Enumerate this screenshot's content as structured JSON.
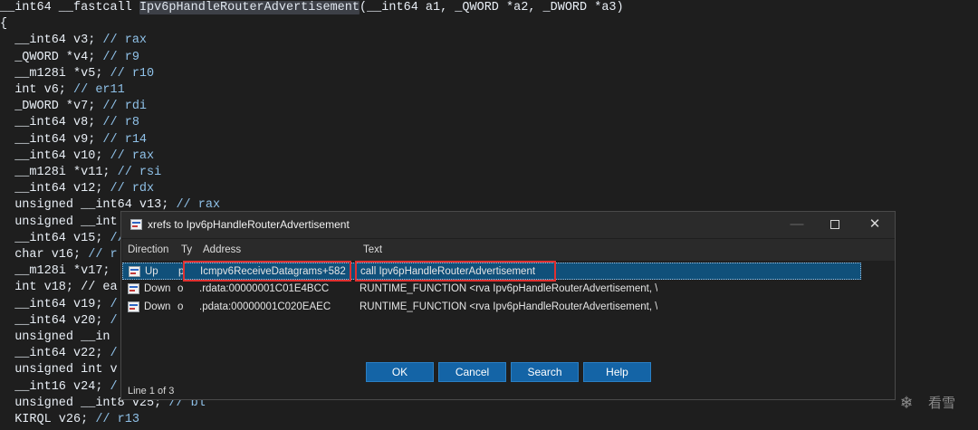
{
  "code": {
    "lines": [
      {
        "pre": "__int64 __fastcall ",
        "hl": "Ipv6pHandleRouterAdvertisement",
        "post": "(__int64 a1, _QWORD *a2, _DWORD *a3)",
        "comment": ""
      },
      {
        "pre": "{",
        "hl": "",
        "post": "",
        "comment": ""
      },
      {
        "pre": "  __int64 v3; ",
        "hl": "",
        "post": "",
        "comment": "// rax"
      },
      {
        "pre": "  _QWORD *v4; ",
        "hl": "",
        "post": "",
        "comment": "// r9"
      },
      {
        "pre": "  __m128i *v5; ",
        "hl": "",
        "post": "",
        "comment": "// r10"
      },
      {
        "pre": "  int v6; ",
        "hl": "",
        "post": "",
        "comment": "// er11"
      },
      {
        "pre": "  _DWORD *v7; ",
        "hl": "",
        "post": "",
        "comment": "// rdi"
      },
      {
        "pre": "  __int64 v8; ",
        "hl": "",
        "post": "",
        "comment": "// r8"
      },
      {
        "pre": "  __int64 v9; ",
        "hl": "",
        "post": "",
        "comment": "// r14"
      },
      {
        "pre": "  __int64 v10; ",
        "hl": "",
        "post": "",
        "comment": "// rax"
      },
      {
        "pre": "  __m128i *v11; ",
        "hl": "",
        "post": "",
        "comment": "// rsi"
      },
      {
        "pre": "  __int64 v12; ",
        "hl": "",
        "post": "",
        "comment": "// rdx"
      },
      {
        "pre": "  unsigned __int64 v13; ",
        "hl": "",
        "post": "",
        "comment": "// rax"
      },
      {
        "pre": "  unsigned __int",
        "hl": "",
        "post": "",
        "comment": ""
      },
      {
        "pre": "  __int64 v15; ",
        "hl": "",
        "post": "",
        "comment": "//"
      },
      {
        "pre": "  char v16; ",
        "hl": "",
        "post": "",
        "comment": "// r"
      },
      {
        "pre": "  __m128i *v17;",
        "hl": "",
        "post": "",
        "comment": ""
      },
      {
        "pre": "  int v18; // ea",
        "hl": "",
        "post": "",
        "comment": ""
      },
      {
        "pre": "  __int64 v19; ",
        "hl": "",
        "post": "",
        "comment": "/"
      },
      {
        "pre": "  __int64 v20; ",
        "hl": "",
        "post": "",
        "comment": "/"
      },
      {
        "pre": "  unsigned __in",
        "hl": "",
        "post": "",
        "comment": ""
      },
      {
        "pre": "  __int64 v22; ",
        "hl": "",
        "post": "",
        "comment": "/"
      },
      {
        "pre": "  unsigned int v",
        "hl": "",
        "post": "",
        "comment": ""
      },
      {
        "pre": "  __int16 v24; ",
        "hl": "",
        "post": "",
        "comment": "/"
      },
      {
        "pre": "  unsigned __int8 v25; ",
        "hl": "",
        "post": "",
        "comment": "// bl"
      },
      {
        "pre": "  KIRQL v26; ",
        "hl": "",
        "post": "",
        "comment": "// r13"
      }
    ]
  },
  "dialog": {
    "title": "xrefs to Ipv6pHandleRouterAdvertisement",
    "minimize": "—",
    "close": "✕",
    "columns": {
      "direction": "Direction",
      "type": "Ty",
      "address": "Address",
      "text": "Text"
    },
    "rows": [
      {
        "direction": "Up",
        "type": "p",
        "address": "Icmpv6ReceiveDatagrams+582",
        "text": "call    Ipv6pHandleRouterAdvertisement"
      },
      {
        "direction": "Down",
        "type": "o",
        "address": ".rdata:00000001C01E4BCC",
        "text": "RUNTIME_FUNCTION <rva Ipv6pHandleRouterAdvertisement, \\"
      },
      {
        "direction": "Down",
        "type": "o",
        "address": ".pdata:00000001C020EAEC",
        "text": "RUNTIME_FUNCTION <rva Ipv6pHandleRouterAdvertisement, \\"
      }
    ],
    "buttons": {
      "ok": "OK",
      "cancel": "Cancel",
      "search": "Search",
      "help": "Help"
    },
    "status": "Line 1 of 3"
  },
  "watermark": {
    "icon": "snowflake-icon",
    "glyph": "❄",
    "text": "看雪"
  },
  "colors": {
    "editor_bg": "#1e1e1e",
    "selection": "#10507a",
    "button": "#1464a6",
    "annotation_red": "#e03030"
  }
}
